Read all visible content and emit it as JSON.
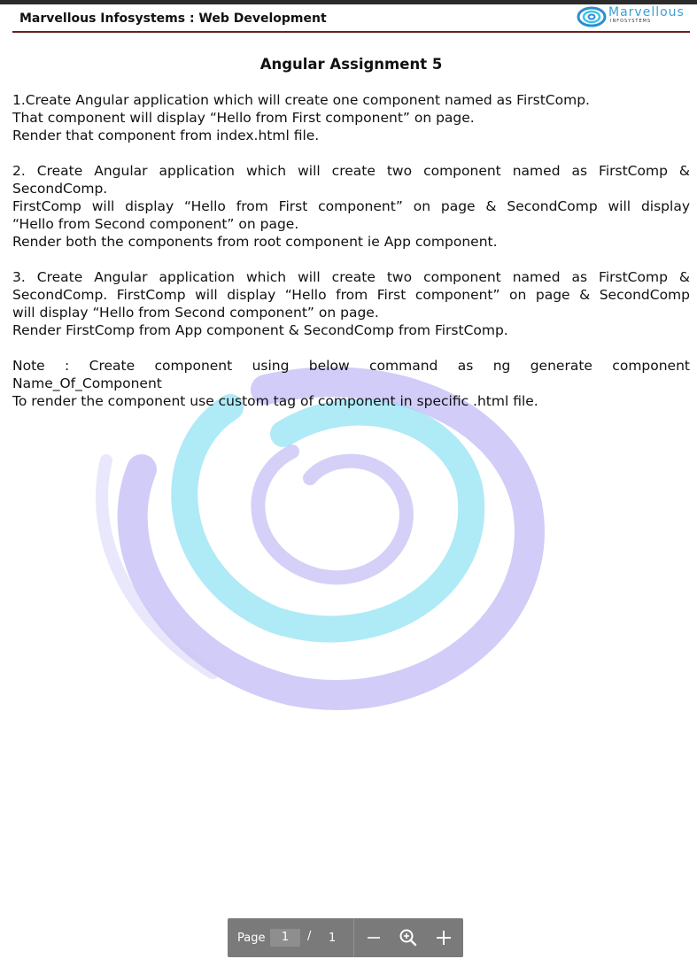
{
  "header": {
    "title": "Marvellous Infosystems : Web Development",
    "logo_text": "Marvellous",
    "logo_sub": "INFOSYSTEMS"
  },
  "document": {
    "title": "Angular Assignment 5",
    "paragraphs": [
      {
        "lines": [
          "1.Create Angular application which will create one component named as FirstComp.",
          "That component will display “Hello from First component” on page.",
          "Render that component from index.html file."
        ]
      },
      {
        "lines": [
          "2. Create Angular application which will create two component named as FirstComp &",
          "SecondComp.",
          "FirstComp will display “Hello from First component” on page & SecondComp will display",
          "“Hello from Second component” on page.",
          "Render both the components from root component ie App component."
        ]
      },
      {
        "lines": [
          "3. Create Angular application which will create two component named as FirstComp &",
          "SecondComp. FirstComp will display “Hello from First component” on page & SecondComp",
          "will display “Hello from Second component” on page.",
          "Render FirstComp from App component & SecondComp from FirstComp."
        ]
      },
      {
        "lines": [
          "Note : Create component using below command as ng generate component",
          "Name_Of_Component",
          "To render the component use custom tag of component in specific .html file."
        ]
      }
    ]
  },
  "pager": {
    "page_label": "Page",
    "current_page": "1",
    "separator": "/",
    "total_pages": "1"
  },
  "colors": {
    "header_rule": "#6b1f1f",
    "watermark_purple": "#9d92f0",
    "watermark_cyan": "#6fd8f0",
    "pager_bg": "#7a7a7a"
  }
}
